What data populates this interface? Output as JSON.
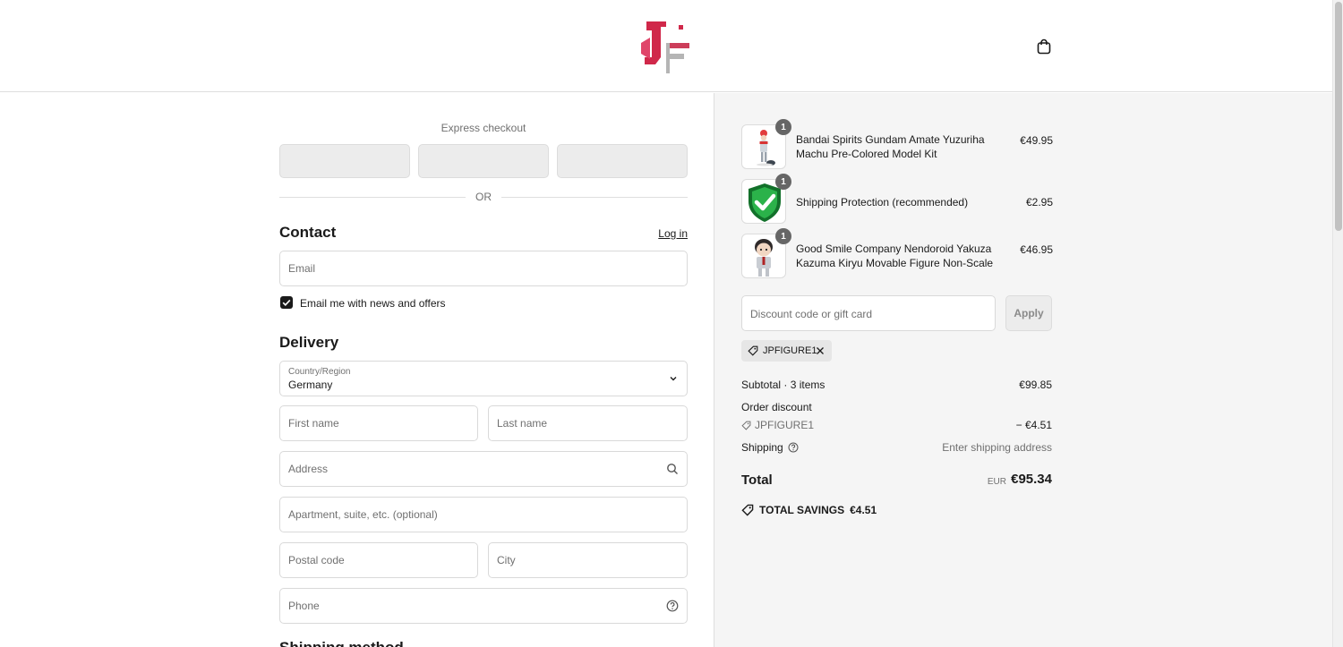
{
  "header": {
    "logo_alt": "JF",
    "cart_icon": "shopping-bag-icon"
  },
  "express": {
    "label": "Express checkout",
    "or_label": "OR"
  },
  "contact": {
    "heading": "Contact",
    "login_label": "Log in",
    "email_placeholder": "Email",
    "newsletter_label": "Email me with news and offers",
    "newsletter_checked": true
  },
  "delivery": {
    "heading": "Delivery",
    "country_label": "Country/Region",
    "country_value": "Germany",
    "first_name_placeholder": "First name",
    "last_name_placeholder": "Last name",
    "address_placeholder": "Address",
    "apartment_placeholder": "Apartment, suite, etc. (optional)",
    "postal_placeholder": "Postal code",
    "city_placeholder": "City",
    "phone_placeholder": "Phone"
  },
  "shipping_method": {
    "heading": "Shipping method"
  },
  "cart": {
    "items": [
      {
        "name": "Bandai Spirits Gundam Amate Yuzuriha Machu Pre-Colored Model Kit",
        "price": "€49.95",
        "qty": "1"
      },
      {
        "name": "Shipping Protection (recommended)",
        "price": "€2.95",
        "qty": "1"
      },
      {
        "name": "Good Smile Company Nendoroid Yakuza Kazuma Kiryu Movable Figure Non-Scale",
        "price": "€46.95",
        "qty": "1"
      }
    ],
    "discount_placeholder": "Discount code or gift card",
    "apply_label": "Apply",
    "applied_code": "JPFIGURE1"
  },
  "summary": {
    "subtotal_label": "Subtotal · 3 items",
    "subtotal_value": "€99.85",
    "order_discount_label": "Order discount",
    "discount_code": "JPFIGURE1",
    "discount_value": "− €4.51",
    "shipping_label": "Shipping",
    "shipping_value": "Enter shipping address",
    "total_label": "Total",
    "total_currency": "EUR",
    "total_value": "€95.34",
    "savings_label": "TOTAL SAVINGS",
    "savings_value": "€4.51"
  },
  "colors": {
    "brand_red": "#d0284a",
    "text": "#1a1a1a",
    "muted": "#707070",
    "panel_bg": "#f5f5f5",
    "shield_green": "#1f9a3a"
  }
}
